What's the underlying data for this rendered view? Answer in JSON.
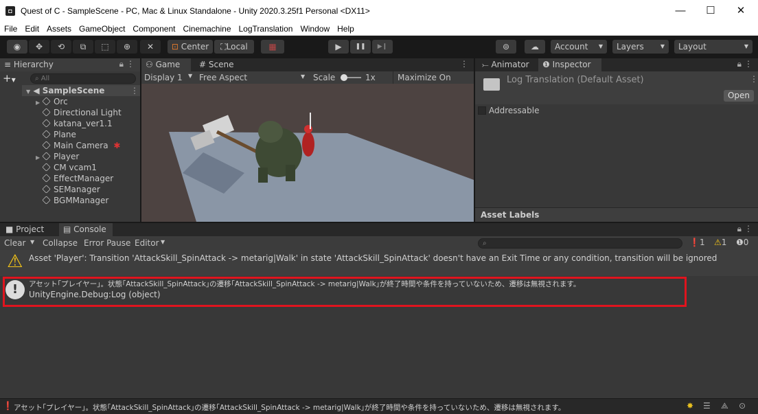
{
  "window": {
    "title": "Quest of C - SampleScene - PC, Mac & Linux Standalone - Unity 2020.3.25f1 Personal <DX11>",
    "minimize": "—",
    "maximize": "☐",
    "close": "✕",
    "app_icon": "◘"
  },
  "menu": [
    "File",
    "Edit",
    "Assets",
    "GameObject",
    "Component",
    "Cinemachine",
    "LogTranslation",
    "Window",
    "Help"
  ],
  "toolbar": {
    "pivot": "Center",
    "space": "Local",
    "account": "Account",
    "layers": "Layers",
    "layout": "Layout",
    "play": "▶",
    "pause": "❚❚",
    "step": "▶❙"
  },
  "hierarchy": {
    "tab": "Hierarchy",
    "search_placeholder": "All",
    "scene": "SampleScene",
    "items": [
      "Orc",
      "Directional Light",
      "katana_ver1.1",
      "Plane",
      "Main Camera",
      "Player",
      "CM vcam1",
      "EffectManager",
      "SEManager",
      "BGMManager"
    ]
  },
  "game": {
    "tab_game": "Game",
    "tab_scene": "Scene",
    "display": "Display 1",
    "aspect": "Free Aspect",
    "scale_label": "Scale",
    "scale_value": "1x",
    "maximize_on_play": "Maximize On Play"
  },
  "inspector": {
    "tab_animator": "Animator",
    "tab_inspector": "Inspector",
    "asset_title": "Log Translation (Default Asset)",
    "open": "Open",
    "addressable": "Addressable",
    "asset_labels": "Asset Labels"
  },
  "console": {
    "tab_project": "Project",
    "tab_console": "Console",
    "clear": "Clear",
    "collapse": "Collapse",
    "error_pause": "Error Pause",
    "editor": "Editor",
    "log_count": "1",
    "warn_count": "1",
    "error_count": "0",
    "warning_message": "Asset 'Player': Transition 'AttackSkill_SpinAttack -> metarig|Walk' in state 'AttackSkill_SpinAttack' doesn't have an Exit Time or any condition, transition will be ignored",
    "log_message": "アセット｢プレイヤー｣。状態｢AttackSkill_SpinAttack｣の遷移｢AttackSkill_SpinAttack -> metarig|Walk｣が終了時間や条件を持っていないため、遷移は無視されます。",
    "log_source": "UnityEngine.Debug:Log (object)"
  },
  "statusbar": {
    "message": "アセット｢プレイヤー｣。状態｢AttackSkill_SpinAttack｣の遷移｢AttackSkill_SpinAttack -> metarig|Walk｣が終了時間や条件を持っていないため、遷移は無視されます。"
  },
  "colors": {
    "highlight_box": "#e0141e",
    "panel": "#383838",
    "tabbar": "#282828",
    "warning": "#f5c518",
    "play_button_bg": "#3a3a3a"
  }
}
